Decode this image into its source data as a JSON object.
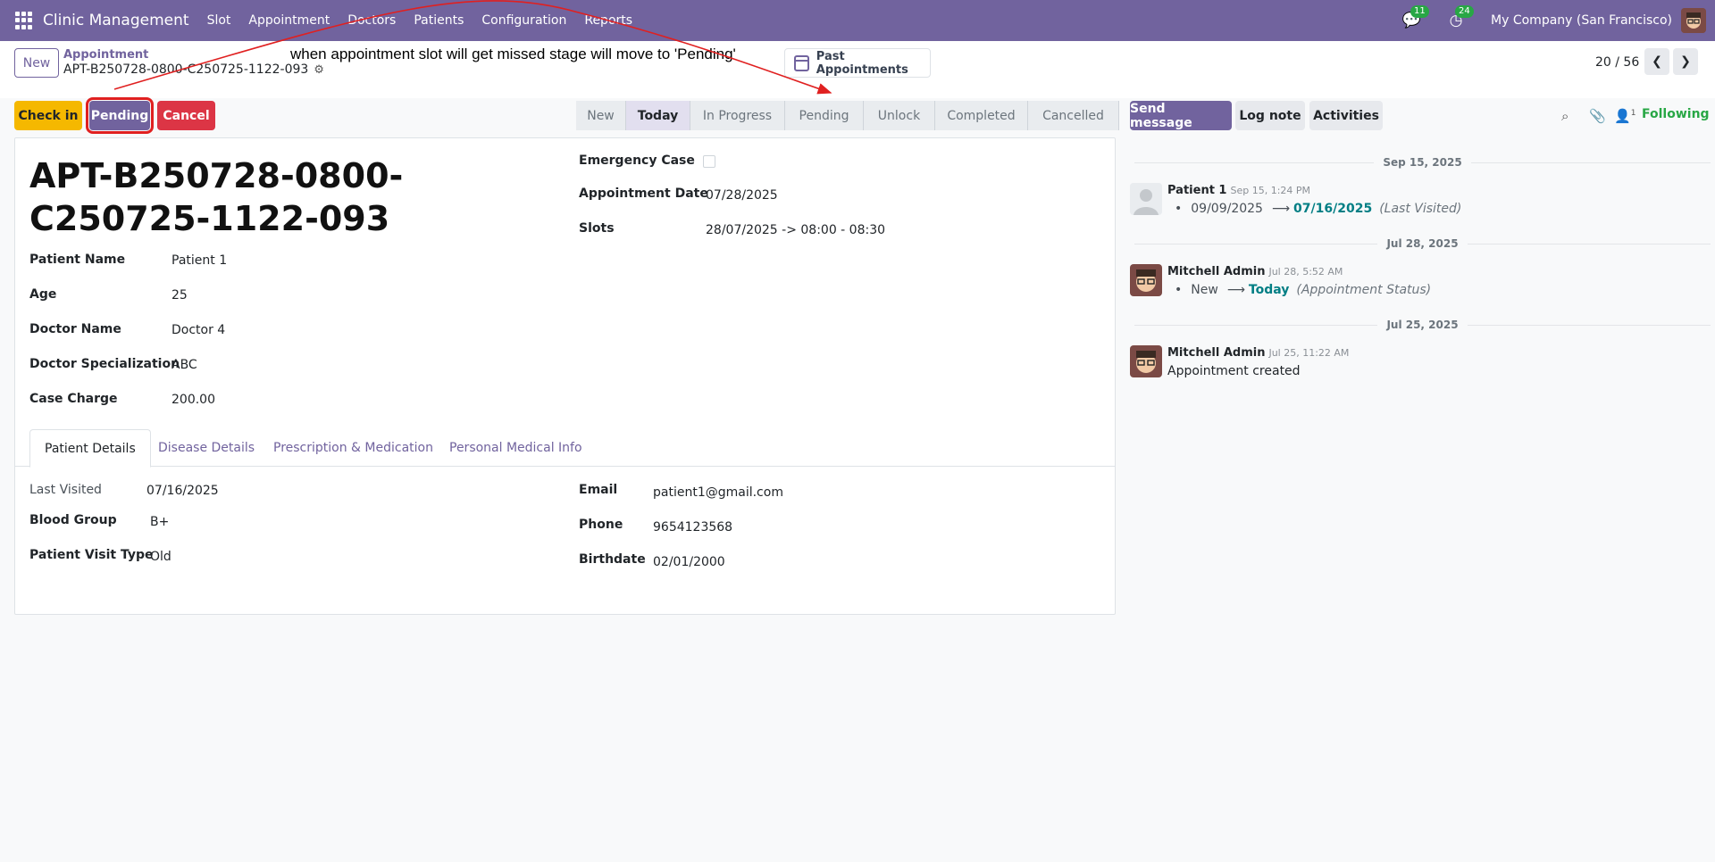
{
  "nav": {
    "brand": "Clinic Management",
    "menu": [
      "Slot",
      "Appointment",
      "Doctors",
      "Patients",
      "Configuration",
      "Reports"
    ],
    "messages_count": "11",
    "activities_count": "24",
    "company": "My Company (San Francisco)"
  },
  "control": {
    "new_label": "New",
    "breadcrumb_parent": "Appointment",
    "breadcrumb_current": "APT-B250728-0800-C250725-1122-093",
    "annotation": "when appointment slot will get missed stage will move to 'Pending'",
    "past_appointments": "Past Appointments",
    "pager": "20 / 56"
  },
  "actions": {
    "checkin": "Check in",
    "pending": "Pending",
    "cancel": "Cancel"
  },
  "stages": [
    "New",
    "Today",
    "In Progress",
    "Pending",
    "Unlock",
    "Completed",
    "Cancelled"
  ],
  "active_stage": "Today",
  "form": {
    "title": "APT-B250728-0800-C250725-1122-093",
    "patient_name_label": "Patient Name",
    "patient_name": "Patient 1",
    "age_label": "Age",
    "age": "25",
    "doctor_name_label": "Doctor Name",
    "doctor_name": "Doctor 4",
    "specialization_label": "Doctor Specialization",
    "specialization": "ABC",
    "case_charge_label": "Case Charge",
    "case_charge": "200.00",
    "emergency_label": "Emergency Case",
    "emergency": false,
    "appt_date_label": "Appointment Date",
    "appt_date": "07/28/2025",
    "slots_label": "Slots",
    "slots": "28/07/2025 -> 08:00 - 08:30"
  },
  "tabs": [
    "Patient Details",
    "Disease Details",
    "Prescription & Medication",
    "Personal Medical Info"
  ],
  "patient_details": {
    "last_visited_label": "Last Visited",
    "last_visited": "07/16/2025",
    "blood_group_label": "Blood Group",
    "blood_group": "B+",
    "visit_type_label": "Patient Visit Type",
    "visit_type": "Old",
    "email_label": "Email",
    "email": "patient1@gmail.com",
    "phone_label": "Phone",
    "phone": "9654123568",
    "birthdate_label": "Birthdate",
    "birthdate": "02/01/2000"
  },
  "chatter": {
    "send_message": "Send message",
    "log_note": "Log note",
    "activities": "Activities",
    "followers_count": "1",
    "following": "Following",
    "messages": [
      {
        "date": "Sep 15, 2025",
        "author": "Patient 1",
        "time": "Sep 15, 1:24 PM",
        "old": "09/09/2025",
        "new": "07/16/2025",
        "field": "(Last Visited)"
      },
      {
        "date": "Jul 28, 2025",
        "author": "Mitchell Admin",
        "time": "Jul 28, 5:52 AM",
        "old": "New",
        "new": "Today",
        "field": "(Appointment Status)"
      },
      {
        "date": "Jul 25, 2025",
        "author": "Mitchell Admin",
        "time": "Jul 25, 11:22 AM",
        "body": "Appointment created"
      }
    ]
  },
  "colors": {
    "brand": "#71639e",
    "warning": "#f5b800",
    "danger": "#dc3545",
    "success": "#28a745",
    "annotation_arrow": "#e02020"
  }
}
